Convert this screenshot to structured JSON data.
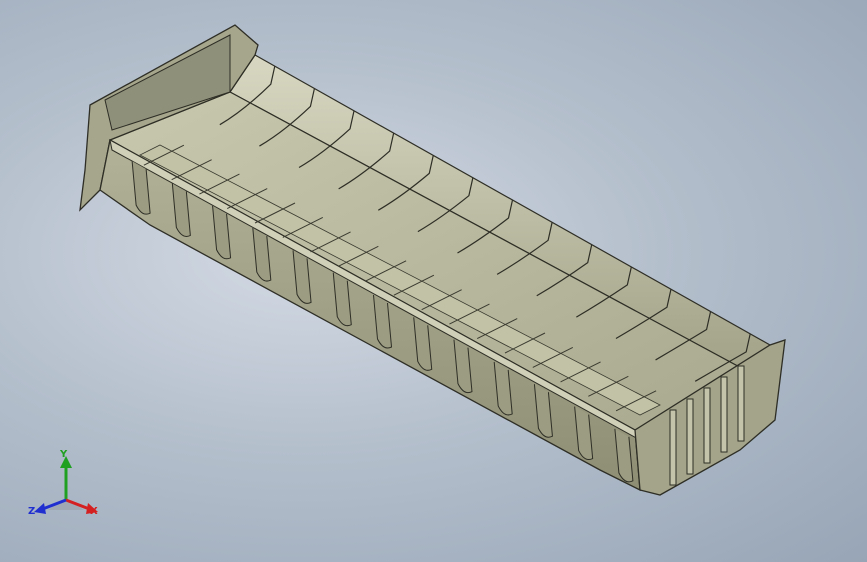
{
  "viewport": {
    "background": "#b4bfcc",
    "model": {
      "name": "dump-truck-body",
      "body_color": "#b7b79c",
      "shadow_color": "#8d8d74",
      "edge_color": "#2e2e26",
      "rib_count": 13
    }
  },
  "triad": {
    "x_label": "X",
    "y_label": "Y",
    "z_label": "Z",
    "x_color": "#d42020",
    "y_color": "#20a020",
    "z_color": "#2030d0"
  }
}
